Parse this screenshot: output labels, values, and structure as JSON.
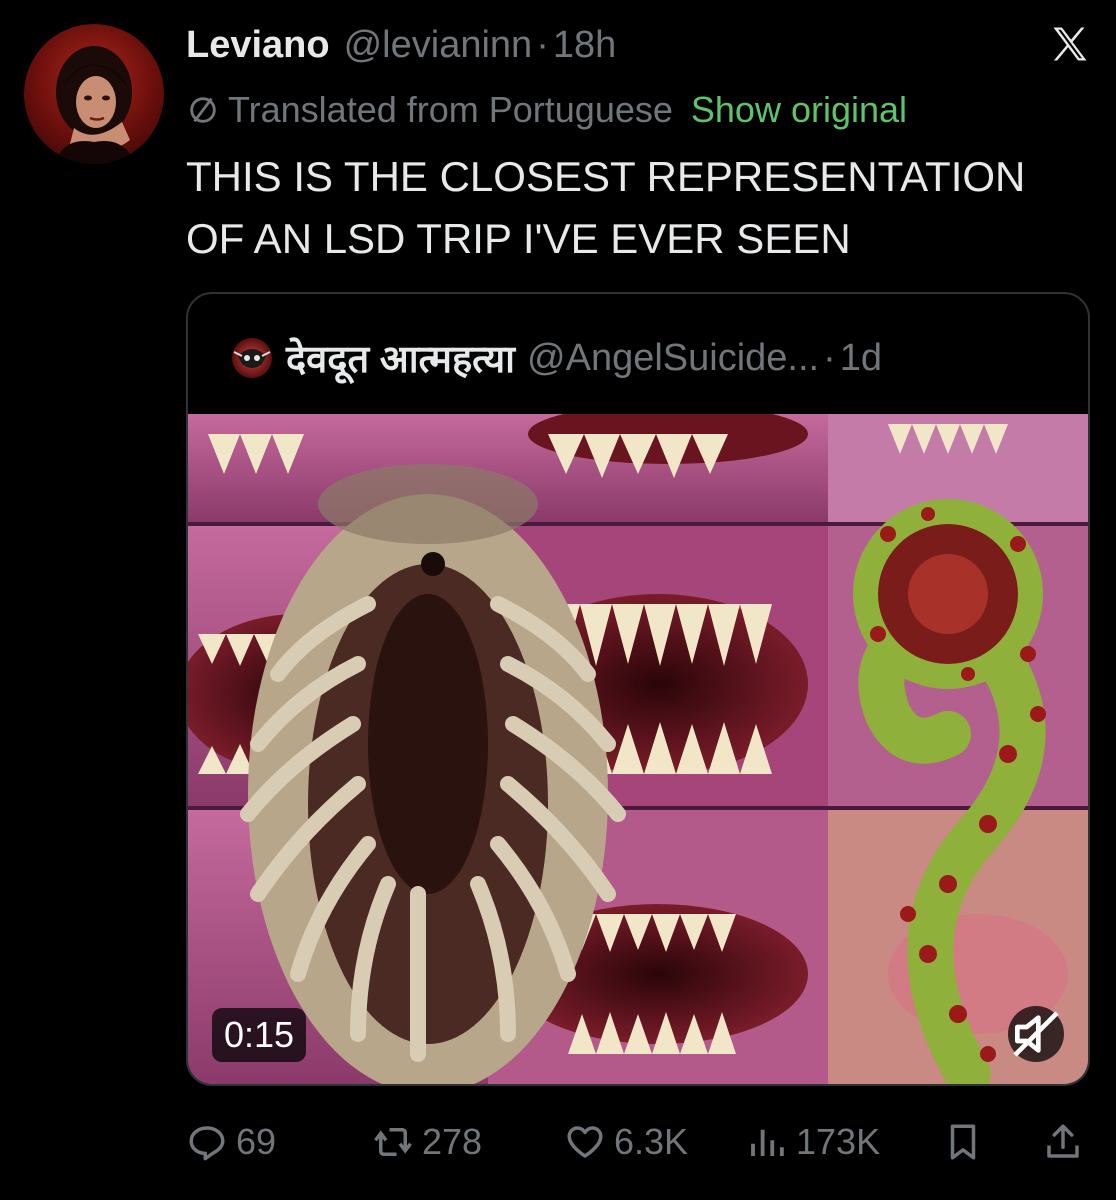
{
  "tweet": {
    "display_name": "Leviano",
    "handle": "@levianinn",
    "separator": "·",
    "time": "18h",
    "translation_note": "Translated from Portuguese",
    "show_original": "Show original",
    "text": "THIS IS THE CLOSEST REPRESENTATION\nOF AN LSD TRIP I'VE EVER SEEN"
  },
  "quoted_tweet": {
    "display_name": "देवदूत आत्महत्या",
    "handle": "@AngelSuicide...",
    "separator": "·",
    "time": "1d",
    "media": {
      "type": "video",
      "duration": "0:15",
      "muted": true
    }
  },
  "actions": {
    "replies": "69",
    "reposts": "278",
    "likes": "6.3K",
    "views": "173K"
  },
  "icons": [
    "x-logo-icon",
    "translate-icon",
    "reply-icon",
    "repost-icon",
    "like-icon",
    "views-icon",
    "bookmark-icon",
    "share-icon",
    "mute-icon"
  ],
  "colors": {
    "background": "#000000",
    "text": "#e7e9ea",
    "secondary": "#71767b",
    "link": "#5ec46a",
    "border": "#2f3336"
  }
}
